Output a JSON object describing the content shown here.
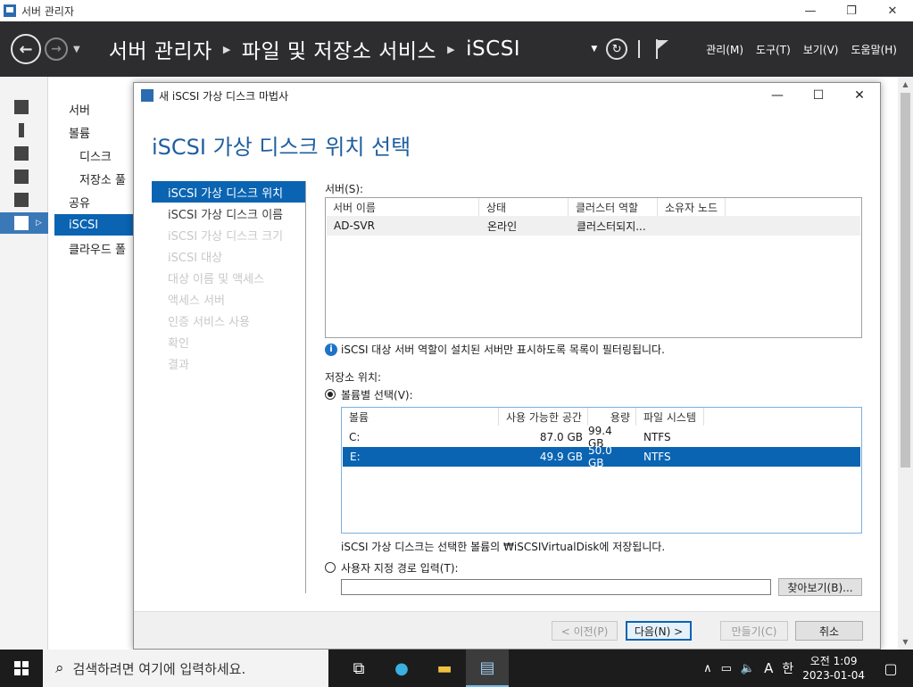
{
  "window": {
    "title": "서버 관리자",
    "minimize": "—",
    "maximize": "❐",
    "close": "✕"
  },
  "header": {
    "breadcrumb": [
      "서버 관리자",
      "파일 및 저장소 서비스",
      "iSCSI"
    ],
    "menus": [
      "관리(M)",
      "도구(T)",
      "보기(V)",
      "도움말(H)"
    ]
  },
  "tree": {
    "items": [
      {
        "label": "서버",
        "sub": false,
        "active": false
      },
      {
        "label": "볼륨",
        "sub": false,
        "active": false
      },
      {
        "label": "디스크",
        "sub": true,
        "active": false
      },
      {
        "label": "저장소 풀",
        "sub": true,
        "active": false
      },
      {
        "label": "공유",
        "sub": false,
        "active": false
      },
      {
        "label": "iSCSI",
        "sub": false,
        "active": true
      },
      {
        "label": "클라우드 폴",
        "sub": false,
        "active": false
      }
    ]
  },
  "wizard": {
    "title": "새 iSCSI 가상 디스크 마법사",
    "heading": "iSCSI 가상 디스크 위치 선택",
    "steps": [
      {
        "label": "iSCSI 가상 디스크 위치",
        "state": "active"
      },
      {
        "label": "iSCSI 가상 디스크 이름",
        "state": "done"
      },
      {
        "label": "iSCSI 가상 디스크 크기",
        "state": "disabled"
      },
      {
        "label": "iSCSI 대상",
        "state": "disabled"
      },
      {
        "label": "대상 이름 및 액세스",
        "state": "disabled"
      },
      {
        "label": "액세스 서버",
        "state": "disabled"
      },
      {
        "label": "인증 서비스 사용",
        "state": "disabled"
      },
      {
        "label": "확인",
        "state": "disabled"
      },
      {
        "label": "결과",
        "state": "disabled"
      }
    ],
    "server_label": "서버(S):",
    "server_columns": [
      "서버 이름",
      "상태",
      "클러스터 역할",
      "소유자 노드"
    ],
    "server_rows": [
      [
        "AD-SVR",
        "온라인",
        "클러스터되지...",
        ""
      ]
    ],
    "info_text": "iSCSI 대상 서버 역할이 설치된 서버만 표시하도록 목록이 필터링됩니다.",
    "storage_label": "저장소 위치:",
    "radio_volume": "볼륨별 선택(V):",
    "volume_columns": [
      "볼륨",
      "사용 가능한 공간",
      "용량",
      "파일 시스템"
    ],
    "volume_rows": [
      [
        "C:",
        "87.0 GB",
        "99.4 GB",
        "NTFS"
      ],
      [
        "E:",
        "49.9 GB",
        "50.0 GB",
        "NTFS"
      ]
    ],
    "volume_note": "iSCSI 가상 디스크는 선택한 볼륨의 ₩iSCSIVirtualDisk에 저장됩니다.",
    "radio_custom": "사용자 지정 경로 입력(T):",
    "custom_path": "",
    "browse": "찾아보기(B)...",
    "buttons": {
      "prev": "< 이전(P)",
      "next": "다음(N) >",
      "create": "만들기(C)",
      "cancel": "취소"
    }
  },
  "taskbar": {
    "search_placeholder": "검색하려면 여기에 입력하세요.",
    "time_period": "오전 1:09",
    "date": "2023-01-04",
    "ime": "한",
    "lang": "A"
  }
}
